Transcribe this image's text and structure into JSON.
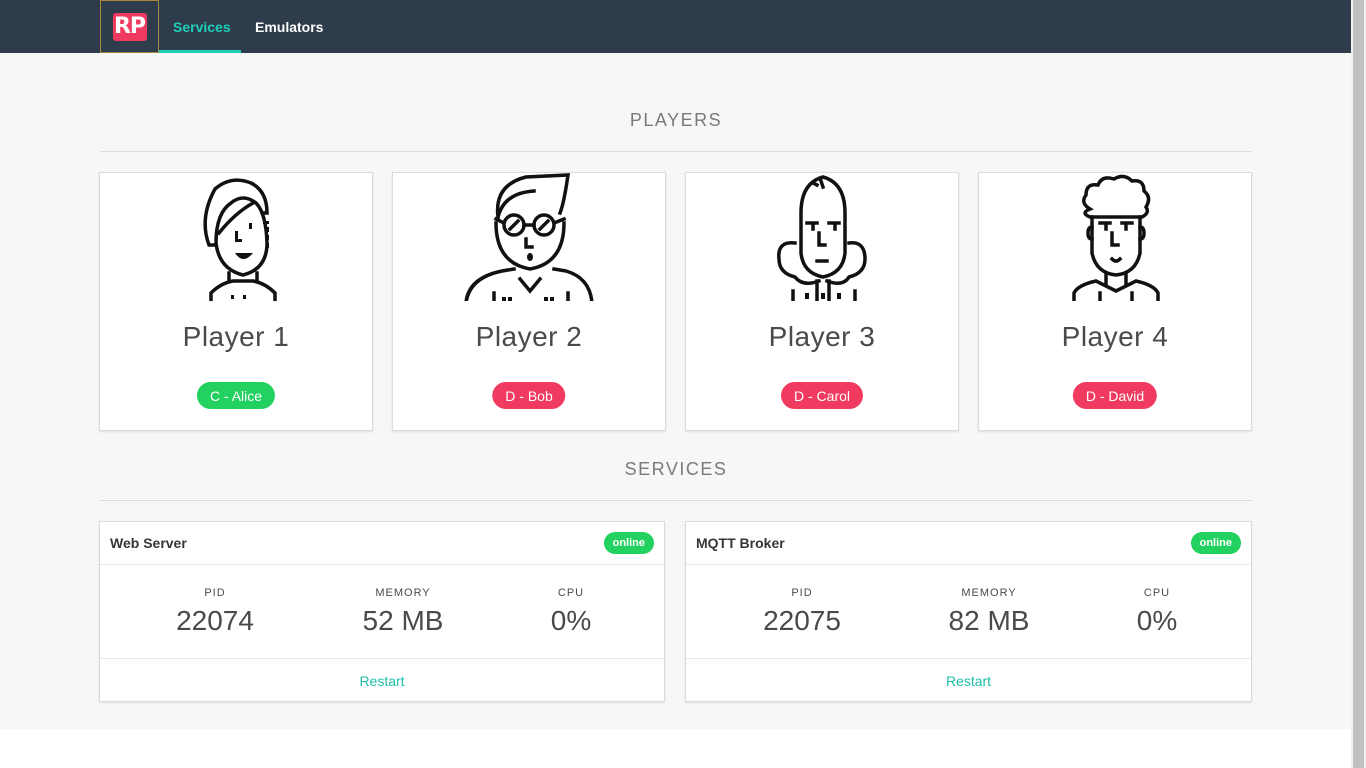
{
  "nav": {
    "logo": "RP",
    "items": [
      {
        "label": "Services",
        "active": true
      },
      {
        "label": "Emulators",
        "active": false
      }
    ]
  },
  "players_section": {
    "title": "PLAYERS",
    "players": [
      {
        "name": "Player 1",
        "tag": "C - Alice",
        "tag_color": "#23d160",
        "avatar": "woman-avatar-icon"
      },
      {
        "name": "Player 2",
        "tag": "D - Bob",
        "tag_color": "#f03a5f",
        "avatar": "man-glasses-avatar-icon"
      },
      {
        "name": "Player 3",
        "tag": "D - Carol",
        "tag_color": "#f03a5f",
        "avatar": "curly-hair-woman-avatar-icon"
      },
      {
        "name": "Player 4",
        "tag": "D - David",
        "tag_color": "#f03a5f",
        "avatar": "curly-hair-man-avatar-icon"
      }
    ]
  },
  "services_section": {
    "title": "SERVICES",
    "services": [
      {
        "name": "Web Server",
        "status": "online",
        "stats": [
          {
            "label": "PID",
            "value": "22074"
          },
          {
            "label": "MEMORY",
            "value": "52 MB"
          },
          {
            "label": "CPU",
            "value": "0%"
          }
        ],
        "action": "Restart"
      },
      {
        "name": "MQTT Broker",
        "status": "online",
        "stats": [
          {
            "label": "PID",
            "value": "22075"
          },
          {
            "label": "MEMORY",
            "value": "82 MB"
          },
          {
            "label": "CPU",
            "value": "0%"
          }
        ],
        "action": "Restart"
      }
    ]
  },
  "colors": {
    "navbar": "#2f3c4b",
    "accent": "#1dd0b6",
    "brand": "#f03a5f",
    "success": "#23d160",
    "danger": "#f03a5f"
  }
}
